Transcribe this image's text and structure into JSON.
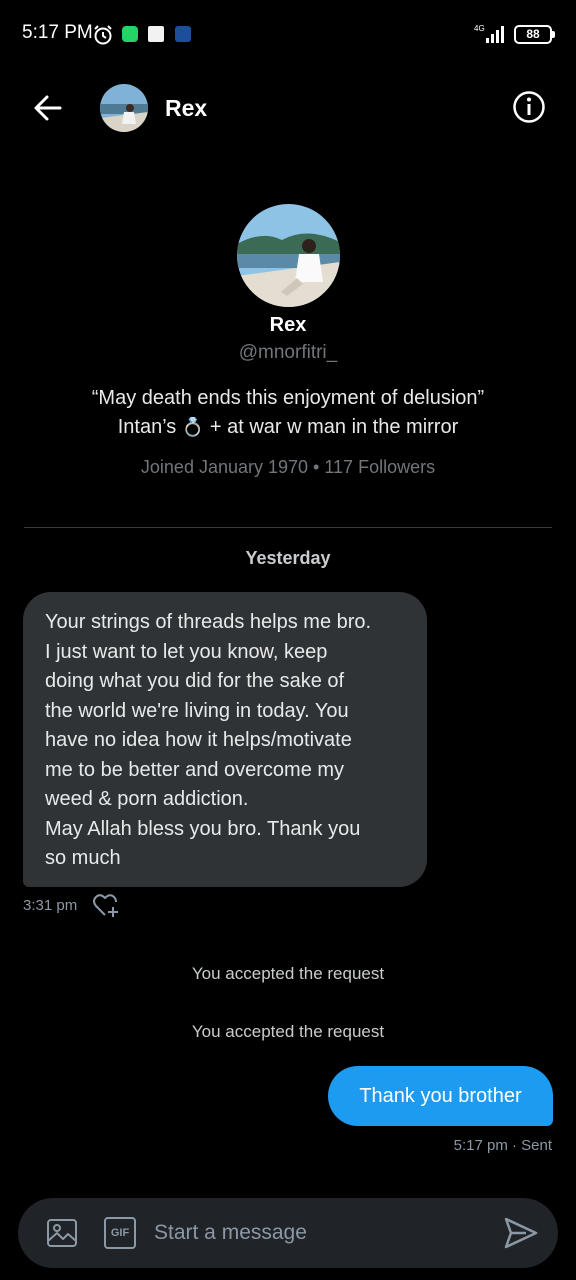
{
  "status_bar": {
    "time": "5:17 PM",
    "network": "4G",
    "battery": "88"
  },
  "header": {
    "name": "Rex"
  },
  "profile": {
    "name": "Rex",
    "handle": "@mnorfitri_",
    "bio_line1": "“May death ends this enjoyment of delusion”",
    "bio_line2_prefix": "Intan’s",
    "bio_emoji": "💍",
    "bio_line2_suffix": "+ at war w man in the mirror",
    "joined": "Joined January 1970",
    "separator": "•",
    "followers": "117 Followers"
  },
  "conversation": {
    "day_label": "Yesterday",
    "received": {
      "text_lines": [
        "Your strings of threads helps me bro.",
        "I just want to let you know, keep",
        "doing what you did for the sake of",
        "the world we're living in today. You",
        "have no idea how it helps/motivate",
        "me to be better and overcome my",
        "weed & porn addiction.",
        "May Allah bless you bro. Thank you",
        "so much"
      ],
      "time": "3:31 pm"
    },
    "system_messages": [
      "You accepted the request",
      "You accepted the request"
    ],
    "sent": {
      "text": "Thank you brother",
      "meta": "5:17 pm · Sent"
    }
  },
  "composer": {
    "placeholder": "Start a message",
    "gif_label": "GIF"
  },
  "colors": {
    "background": "#000000",
    "bubble_in": "#2f3336",
    "bubble_out": "#1d9bf0",
    "muted_text": "#71767b"
  }
}
